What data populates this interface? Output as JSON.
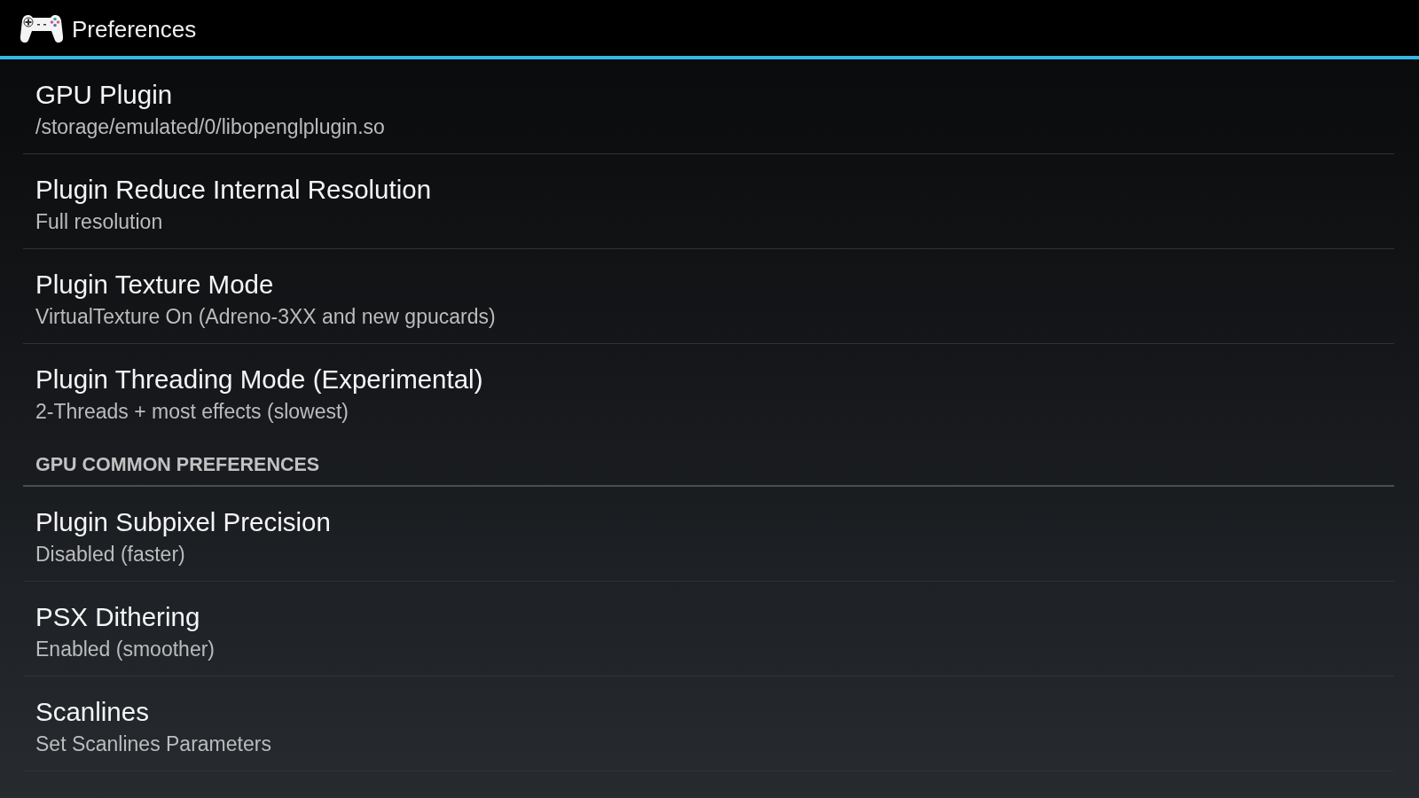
{
  "app_bar": {
    "title": "Preferences"
  },
  "sections": [
    {
      "items": [
        {
          "title": "GPU Plugin",
          "summary": "/storage/emulated/0/libopenglplugin.so"
        },
        {
          "title": "Plugin Reduce Internal Resolution",
          "summary": "Full resolution"
        },
        {
          "title": "Plugin Texture Mode",
          "summary": "VirtualTexture On (Adreno-3XX and new gpucards)"
        },
        {
          "title": "Plugin Threading Mode (Experimental)",
          "summary": "2-Threads + most effects (slowest)"
        }
      ]
    },
    {
      "header": "GPU COMMON PREFERENCES",
      "items": [
        {
          "title": "Plugin Subpixel Precision",
          "summary": "Disabled (faster)"
        },
        {
          "title": "PSX Dithering",
          "summary": "Enabled (smoother)"
        },
        {
          "title": "Scanlines",
          "summary": "Set Scanlines Parameters"
        }
      ]
    }
  ]
}
